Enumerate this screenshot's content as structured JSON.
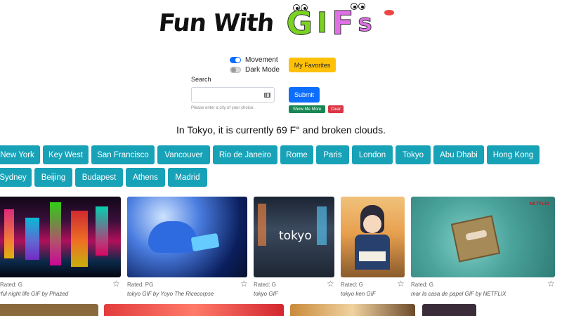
{
  "header": {
    "logo_prefix": "Fun With",
    "logo_letters": [
      "G",
      "I",
      "F",
      "s"
    ]
  },
  "controls": {
    "movement_label": "Movement",
    "movement_on": true,
    "dark_mode_label": "Dark Mode",
    "dark_mode_on": false,
    "favorites_label": "My Favorites",
    "search_label": "Search",
    "search_value": "",
    "search_help": "Please enter a city of your choice.",
    "submit_label": "Submit",
    "show_more_label": "Show Me More",
    "clear_label": "Clear"
  },
  "weather_text": "In Tokyo, it is currently 69 F° and broken clouds.",
  "cities_row1": [
    "New York",
    "Key West",
    "San Francisco",
    "Vancouver",
    "Rio de Janeiro",
    "Rome",
    "Paris",
    "London",
    "Tokyo",
    "Abu Dhabi",
    "Hong Kong"
  ],
  "cities_row2": [
    "Sydney",
    "Beijing",
    "Budapest",
    "Athens",
    "Madrid"
  ],
  "gifs": [
    {
      "rated": "Rated: G",
      "title": "colorful night life GIF by Phazed"
    },
    {
      "rated": "Rated: PG",
      "title": "tokyo GIF by Yoyo The Ricecorpse"
    },
    {
      "rated": "Rated: G",
      "title": "tokyo GIF"
    },
    {
      "rated": "Rated: G",
      "title": "tokyo ken GIF"
    },
    {
      "rated": "Rated: G",
      "title": "mar la casa de papel GIF by NETFLIX"
    }
  ],
  "colors": {
    "primary": "#0d6efd",
    "warning": "#ffc107",
    "success": "#198754",
    "danger": "#dc3545",
    "city_button": "#17a2b8"
  },
  "icons": {
    "favorite": "star-outline-icon",
    "keyboard": "keyboard-icon"
  }
}
